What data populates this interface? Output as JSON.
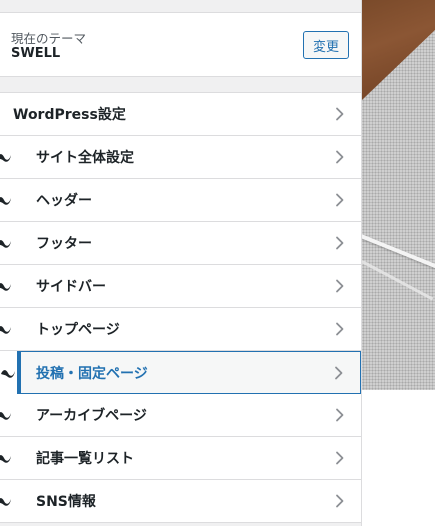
{
  "theme": {
    "caption": "現在のテーマ",
    "name": "SWELL",
    "change_label": "変更"
  },
  "menu": {
    "items": [
      {
        "label": "WordPress設定",
        "swell_icon": false,
        "active": false
      },
      {
        "label": "サイト全体設定",
        "swell_icon": true,
        "active": false
      },
      {
        "label": "ヘッダー",
        "swell_icon": true,
        "active": false
      },
      {
        "label": "フッター",
        "swell_icon": true,
        "active": false
      },
      {
        "label": "サイドバー",
        "swell_icon": true,
        "active": false
      },
      {
        "label": "トップページ",
        "swell_icon": true,
        "active": false
      },
      {
        "label": "投稿・固定ページ",
        "swell_icon": true,
        "active": true
      },
      {
        "label": "アーカイブページ",
        "swell_icon": true,
        "active": false
      },
      {
        "label": "記事一覧リスト",
        "swell_icon": true,
        "active": false
      },
      {
        "label": "SNS情報",
        "swell_icon": true,
        "active": false
      }
    ]
  },
  "icons": {
    "swell": "swell-logo-icon",
    "chevron": "chevron-right-icon"
  },
  "colors": {
    "accent": "#2271b1",
    "text": "#1d2327",
    "border": "#dcdcde",
    "panel_bg": "#f0f0f1"
  }
}
